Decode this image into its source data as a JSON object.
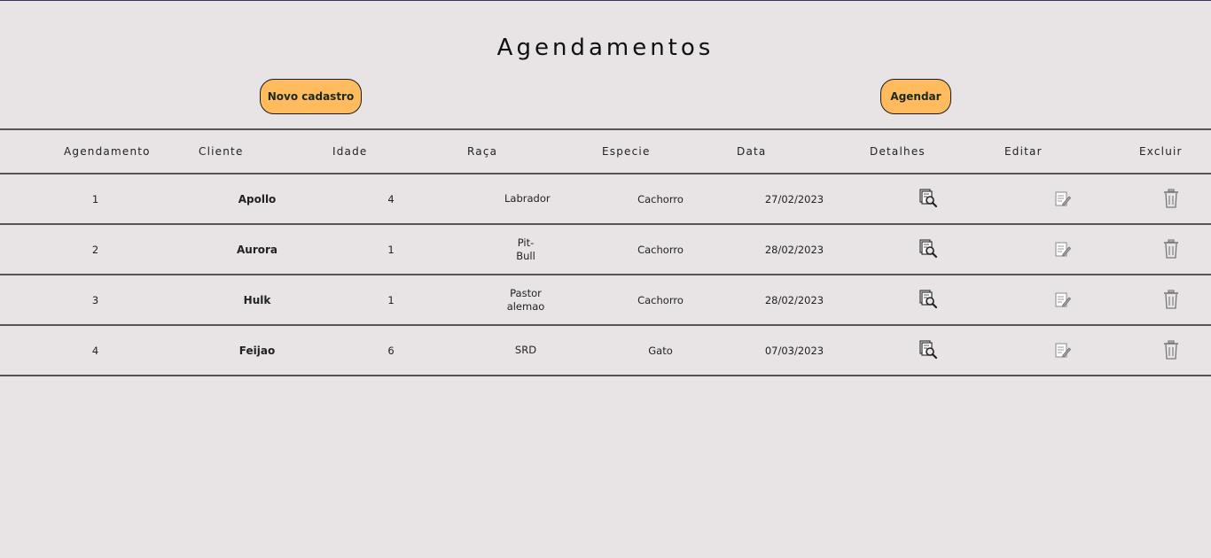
{
  "page": {
    "title": "Agendamentos"
  },
  "buttons": {
    "new_register": "Novo cadastro",
    "schedule": "Agendar"
  },
  "table": {
    "columns": [
      "Agendamento",
      "Cliente",
      "Idade",
      "Raça",
      "Especie",
      "Data",
      "Detalhes",
      "Editar",
      "Excluir"
    ],
    "rows": [
      {
        "id": "1",
        "client": "Apollo",
        "age": "4",
        "breed": "Labrador",
        "species": "Cachorro",
        "date": "27/02/2023"
      },
      {
        "id": "2",
        "client": "Aurora",
        "age": "1",
        "breed": "Pit-Bull",
        "species": "Cachorro",
        "date": "28/02/2023"
      },
      {
        "id": "3",
        "client": "Hulk",
        "age": "1",
        "breed": "Pastor alemao",
        "species": "Cachorro",
        "date": "28/02/2023"
      },
      {
        "id": "4",
        "client": "Feijao",
        "age": "6",
        "breed": "SRD",
        "species": "Gato",
        "date": "07/03/2023"
      }
    ],
    "row_icons": {
      "details": "details-search-icon",
      "edit": "edit-document-icon",
      "delete": "trash-icon"
    }
  },
  "colors": {
    "background": "#e8e4e5",
    "button": "#ffbb5e",
    "accent_red": "#e06060",
    "rule": "#555555"
  }
}
